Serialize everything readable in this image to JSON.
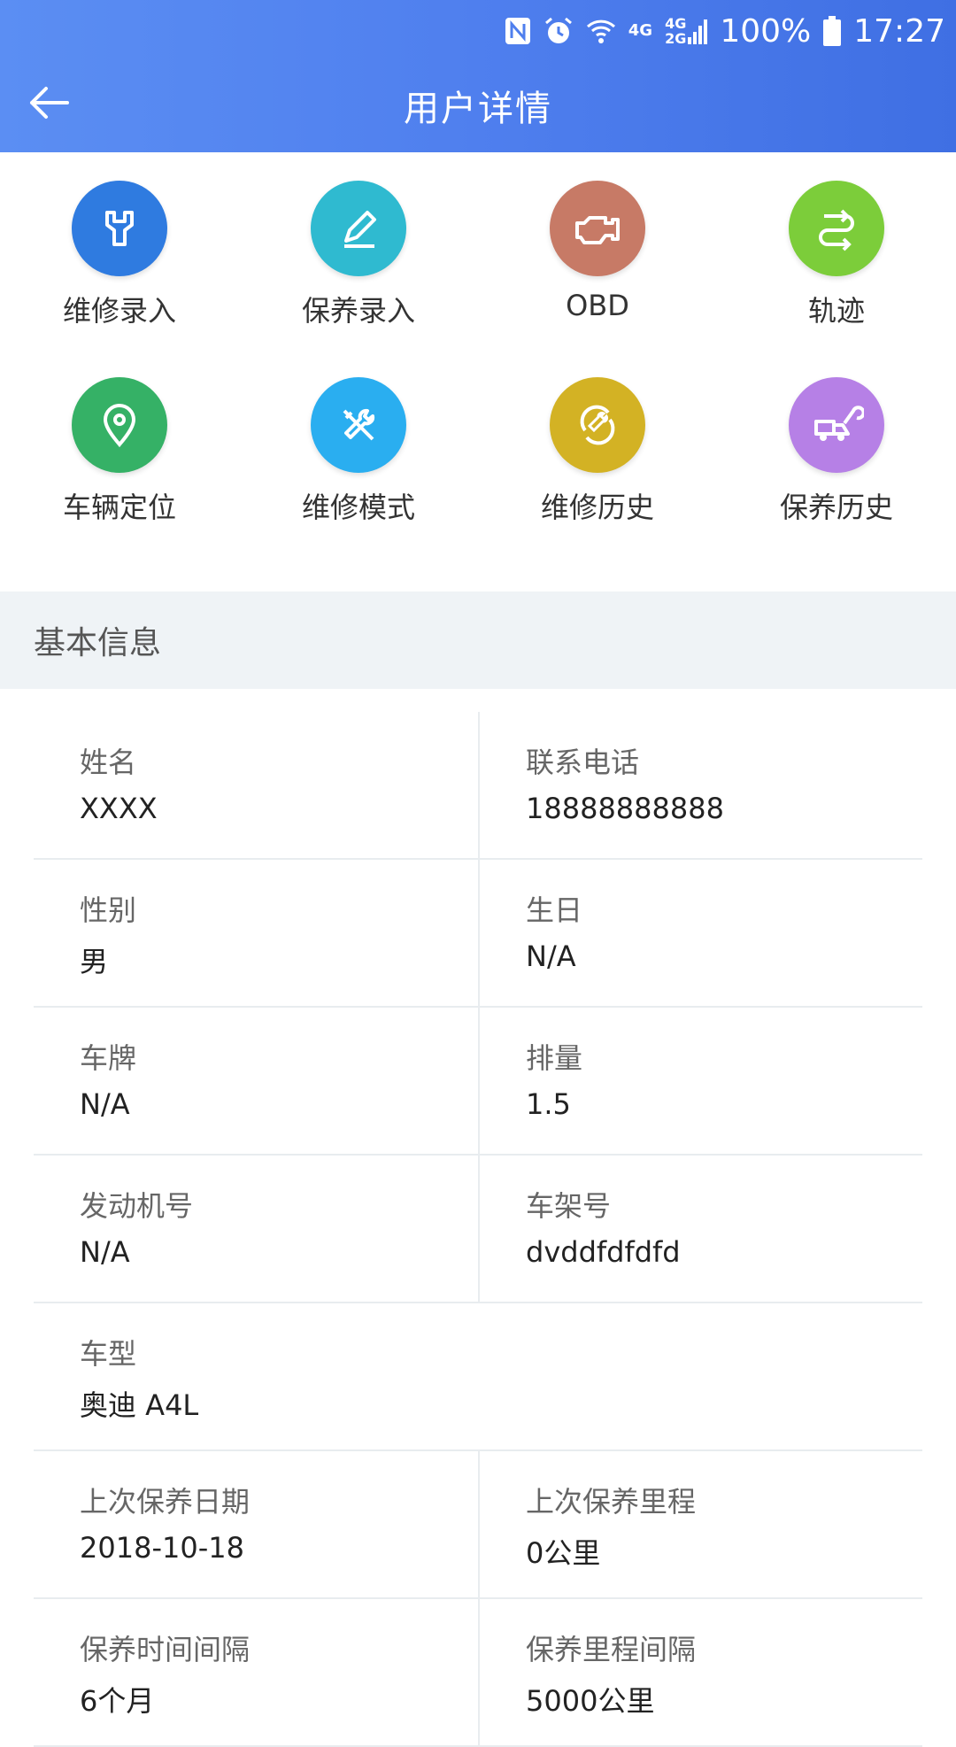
{
  "status_bar": {
    "icons": [
      "nfc-icon",
      "alarm-icon",
      "wifi-icon",
      "signal-4g-icon",
      "signal-4g-2g-icon"
    ],
    "net_label": "4G",
    "net_label2_top": "4G",
    "net_label2_bottom": "2G",
    "battery": "100%",
    "time": "17:27"
  },
  "header": {
    "title": "用户详情"
  },
  "actions": [
    {
      "label": "维修录入",
      "icon": "wrench-icon",
      "color": "#2f7be0"
    },
    {
      "label": "保养录入",
      "icon": "pencil-icon",
      "color": "#2fbad0"
    },
    {
      "label": "OBD",
      "icon": "engine-icon",
      "color": "#c77a66"
    },
    {
      "label": "轨迹",
      "icon": "route-icon",
      "color": "#7ccd3a"
    },
    {
      "label": "车辆定位",
      "icon": "location-pin-icon",
      "color": "#35b166"
    },
    {
      "label": "维修模式",
      "icon": "tools-icon",
      "color": "#2aaef0"
    },
    {
      "label": "维修历史",
      "icon": "repair-history-icon",
      "color": "#d3b224"
    },
    {
      "label": "保养历史",
      "icon": "tow-truck-icon",
      "color": "#b680e6"
    }
  ],
  "section": {
    "title": "基本信息"
  },
  "info": [
    [
      {
        "k": "姓名",
        "v": "XXXX"
      },
      {
        "k": "联系电话",
        "v": "18888888888"
      }
    ],
    [
      {
        "k": "性别",
        "v": "男"
      },
      {
        "k": "生日",
        "v": "N/A"
      }
    ],
    [
      {
        "k": "车牌",
        "v": "N/A"
      },
      {
        "k": "排量",
        "v": "1.5"
      }
    ],
    [
      {
        "k": "发动机号",
        "v": "N/A"
      },
      {
        "k": "车架号",
        "v": "dvddfdfdfd"
      }
    ],
    [
      {
        "k": "车型",
        "v": "奥迪 A4L"
      }
    ],
    [
      {
        "k": "上次保养日期",
        "v": "2018-10-18"
      },
      {
        "k": "上次保养里程",
        "v": "0公里"
      }
    ],
    [
      {
        "k": "保养时间间隔",
        "v": "6个月"
      },
      {
        "k": "保养里程间隔",
        "v": "5000公里"
      }
    ]
  ]
}
